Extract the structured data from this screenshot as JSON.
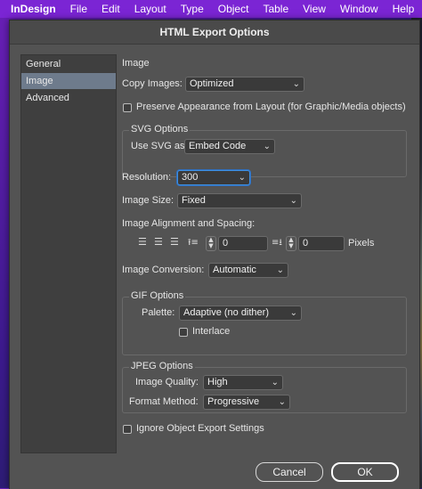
{
  "menubar": {
    "app": "InDesign",
    "items": [
      "File",
      "Edit",
      "Layout",
      "Type",
      "Object",
      "Table",
      "View",
      "Window",
      "Help"
    ]
  },
  "dialog": {
    "title": "HTML Export Options",
    "sidebar": {
      "items": [
        "General",
        "Image",
        "Advanced"
      ],
      "active": "Image"
    },
    "section_title": "Image",
    "copy_images": {
      "label": "Copy Images:",
      "value": "Optimized"
    },
    "preserve_appearance": {
      "label": "Preserve Appearance from Layout (for Graphic/Media objects)",
      "checked": false
    },
    "svg_options": {
      "title": "SVG Options",
      "use_svg_as": {
        "label": "Use SVG as:",
        "value": "Embed Code"
      }
    },
    "resolution": {
      "label": "Resolution:",
      "value": "300"
    },
    "image_size": {
      "label": "Image Size:",
      "value": "Fixed"
    },
    "alignment": {
      "title": "Image Alignment and Spacing:",
      "left_space": "0",
      "bottom_space": "0",
      "units": "Pixels"
    },
    "image_conversion": {
      "label": "Image Conversion:",
      "value": "Automatic"
    },
    "gif_options": {
      "title": "GIF Options",
      "palette": {
        "label": "Palette:",
        "value": "Adaptive (no dither)"
      },
      "interlace": {
        "label": "Interlace",
        "checked": false
      }
    },
    "jpeg_options": {
      "title": "JPEG Options",
      "image_quality": {
        "label": "Image Quality:",
        "value": "High"
      },
      "format_method": {
        "label": "Format Method:",
        "value": "Progressive"
      }
    },
    "ignore_object_export": {
      "label": "Ignore Object Export Settings",
      "checked": false
    },
    "buttons": {
      "cancel": "Cancel",
      "ok": "OK"
    }
  },
  "icons": {
    "chevron": "chevron-down-icon",
    "align_left": "align-left-icon",
    "align_center": "align-center-icon",
    "align_right": "align-right-icon",
    "space_before": "space-before-icon",
    "space_after": "space-after-icon"
  },
  "colors": {
    "menubar": "#7b25d4",
    "dialog_bg": "#535353",
    "sidebar_active": "#6e7b8c",
    "focus_ring": "#3f8fe0"
  }
}
